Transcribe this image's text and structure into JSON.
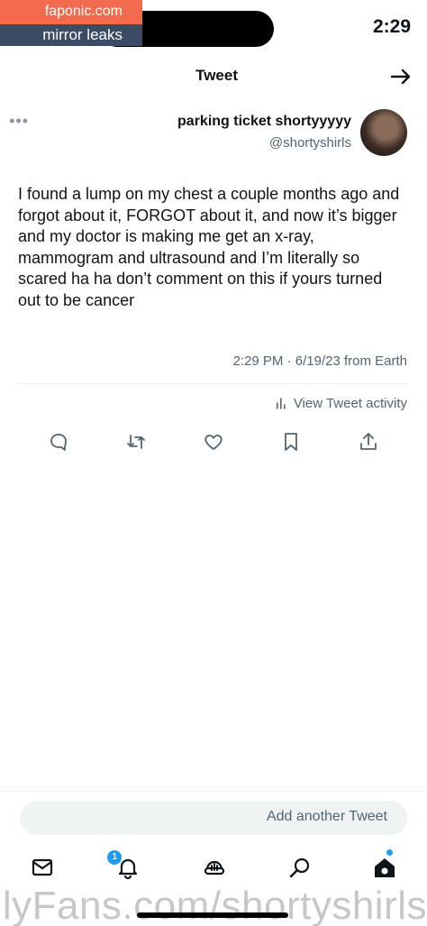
{
  "status_bar": {
    "time": "2:29"
  },
  "watermark": {
    "site": "faponic.com",
    "tagline": "mirror leaks",
    "footer": "OnlyFans.com/shortyshirls"
  },
  "header": {
    "title": "Tweet"
  },
  "tweet": {
    "author_name": "parking ticket shortyyyyy",
    "author_handle": "@shortyshirls",
    "text": "I found a lump on my chest a couple months ago and forgot about it, FORGOT about it, and now it’s bigger and my doctor is making me get an x-ray, mammogram and ultrasound and I’m literally so scared ha ha don’t comment on this if yours turned out to be cancer",
    "timestamp": "2:29 PM · 6/19/23 from Earth",
    "activity_label": "View Tweet activity"
  },
  "actions": [
    "reply-icon",
    "retweet-icon",
    "like-icon",
    "bookmark-icon",
    "share-icon"
  ],
  "reply_bar": {
    "placeholder": "Add another Tweet"
  },
  "bottom_nav": {
    "items": [
      "home-icon",
      "search-icon",
      "spaces-icon",
      "notifications-icon",
      "messages-icon"
    ],
    "notification_badge": "1"
  },
  "colors": {
    "accent": "#1d9bf0",
    "text": "#0f1419",
    "secondary": "#536471",
    "watermark_orange": "#f26b4e",
    "watermark_navy": "#3a4b63"
  }
}
